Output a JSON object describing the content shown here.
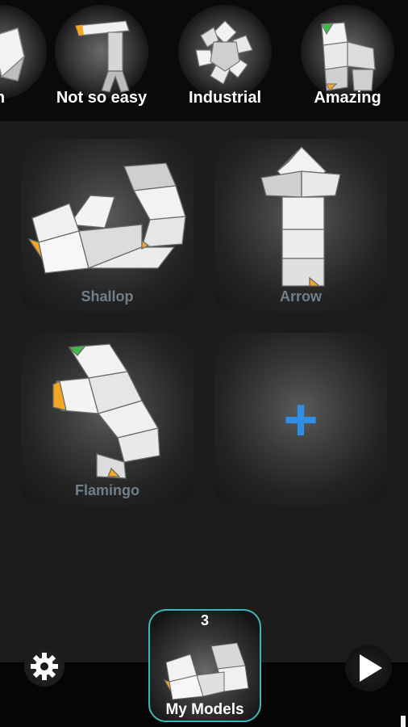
{
  "categories": [
    {
      "label": "h",
      "icon": "snake-model-partial-icon"
    },
    {
      "label": "Not so easy",
      "icon": "snake-model-figure-icon"
    },
    {
      "label": "Industrial",
      "icon": "snake-model-flower-icon"
    },
    {
      "label": "Amazing",
      "icon": "snake-model-amazing-icon"
    }
  ],
  "models": [
    {
      "name": "Shallop",
      "icon": "snake-model-shallop-icon"
    },
    {
      "name": "Arrow",
      "icon": "snake-model-arrow-icon"
    },
    {
      "name": "Flamingo",
      "icon": "snake-model-flamingo-icon"
    }
  ],
  "add_button": {
    "glyph": "+",
    "icon": "plus-icon"
  },
  "my_models": {
    "count": "3",
    "label": "My Models"
  },
  "settings": {
    "icon": "gear-icon"
  },
  "play": {
    "icon": "play-icon"
  },
  "colors": {
    "accent_teal": "#3fb6b6",
    "plus_blue": "#2f8fe6",
    "piece_orange": "#f5a623",
    "piece_green": "#3dbb4a",
    "label_gray": "#6f7f8c"
  }
}
